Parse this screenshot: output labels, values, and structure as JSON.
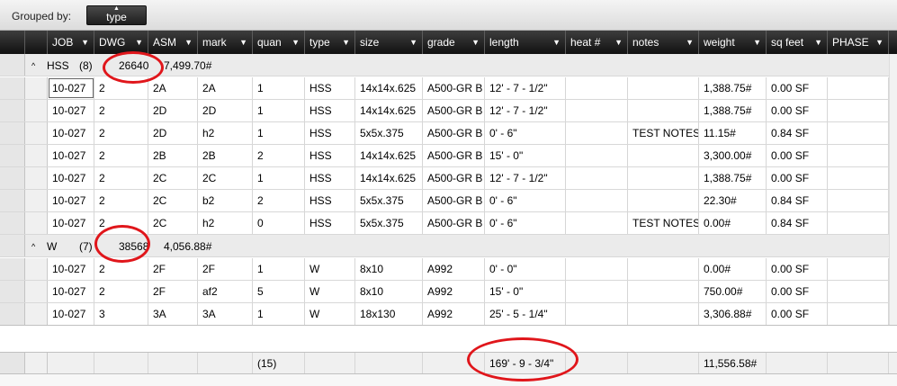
{
  "grouping": {
    "label": "Grouped by:",
    "chip": "type"
  },
  "columns": [
    {
      "key": "job",
      "label": "JOB"
    },
    {
      "key": "dwg",
      "label": "DWG"
    },
    {
      "key": "asm",
      "label": "ASM"
    },
    {
      "key": "mark",
      "label": "mark"
    },
    {
      "key": "quan",
      "label": "quan"
    },
    {
      "key": "type",
      "label": "type"
    },
    {
      "key": "size",
      "label": "size"
    },
    {
      "key": "grade",
      "label": "grade"
    },
    {
      "key": "length",
      "label": "length"
    },
    {
      "key": "heat",
      "label": "heat #"
    },
    {
      "key": "notes",
      "label": "notes"
    },
    {
      "key": "weight",
      "label": "weight"
    },
    {
      "key": "sqfeet",
      "label": "sq feet"
    },
    {
      "key": "phase",
      "label": "PHASE"
    }
  ],
  "groups": [
    {
      "name": "HSS",
      "count": "(8)",
      "id": "26640",
      "total": "7,499.70#",
      "rows": [
        [
          "10-027",
          "2",
          "2A",
          "2A",
          "1",
          "HSS",
          "14x14x.625",
          "A500-GR B",
          "12' - 7 - 1/2\"",
          "",
          "",
          "1,388.75#",
          "0.00 SF",
          ""
        ],
        [
          "10-027",
          "2",
          "2D",
          "2D",
          "1",
          "HSS",
          "14x14x.625",
          "A500-GR B",
          "12' - 7 - 1/2\"",
          "",
          "",
          "1,388.75#",
          "0.00 SF",
          ""
        ],
        [
          "10-027",
          "2",
          "2D",
          "h2",
          "1",
          "HSS",
          "5x5x.375",
          "A500-GR B",
          "0' - 6\"",
          "",
          "TEST NOTES",
          "11.15#",
          "0.84 SF",
          ""
        ],
        [
          "10-027",
          "2",
          "2B",
          "2B",
          "2",
          "HSS",
          "14x14x.625",
          "A500-GR B",
          "15' - 0\"",
          "",
          "",
          "3,300.00#",
          "0.00 SF",
          ""
        ],
        [
          "10-027",
          "2",
          "2C",
          "2C",
          "1",
          "HSS",
          "14x14x.625",
          "A500-GR B",
          "12' - 7 - 1/2\"",
          "",
          "",
          "1,388.75#",
          "0.00 SF",
          ""
        ],
        [
          "10-027",
          "2",
          "2C",
          "b2",
          "2",
          "HSS",
          "5x5x.375",
          "A500-GR B",
          "0' - 6\"",
          "",
          "",
          "22.30#",
          "0.84 SF",
          ""
        ],
        [
          "10-027",
          "2",
          "2C",
          "h2",
          "0",
          "HSS",
          "5x5x.375",
          "A500-GR B",
          "0' - 6\"",
          "",
          "TEST NOTES",
          "0.00#",
          "0.84 SF",
          ""
        ]
      ]
    },
    {
      "name": "W",
      "count": "(7)",
      "id": "38568",
      "total": "4,056.88#",
      "rows": [
        [
          "10-027",
          "2",
          "2F",
          "2F",
          "1",
          "W",
          "8x10",
          "A992",
          "0' - 0\"",
          "",
          "",
          "0.00#",
          "0.00 SF",
          ""
        ],
        [
          "10-027",
          "2",
          "2F",
          "af2",
          "5",
          "W",
          "8x10",
          "A992",
          "15' - 0\"",
          "",
          "",
          "750.00#",
          "0.00 SF",
          ""
        ],
        [
          "10-027",
          "3",
          "3A",
          "3A",
          "1",
          "W",
          "18x130",
          "A992",
          "25' - 5 - 1/4\"",
          "",
          "",
          "3,306.88#",
          "0.00 SF",
          ""
        ]
      ]
    }
  ],
  "totals": {
    "quan": "(15)",
    "length": "169' - 9 - 3/4\"",
    "weight": "11,556.58#"
  },
  "colors": {
    "header_bg": "#1e1e1e",
    "group_bg": "#ebebeb",
    "annotation": "#e0161b"
  }
}
